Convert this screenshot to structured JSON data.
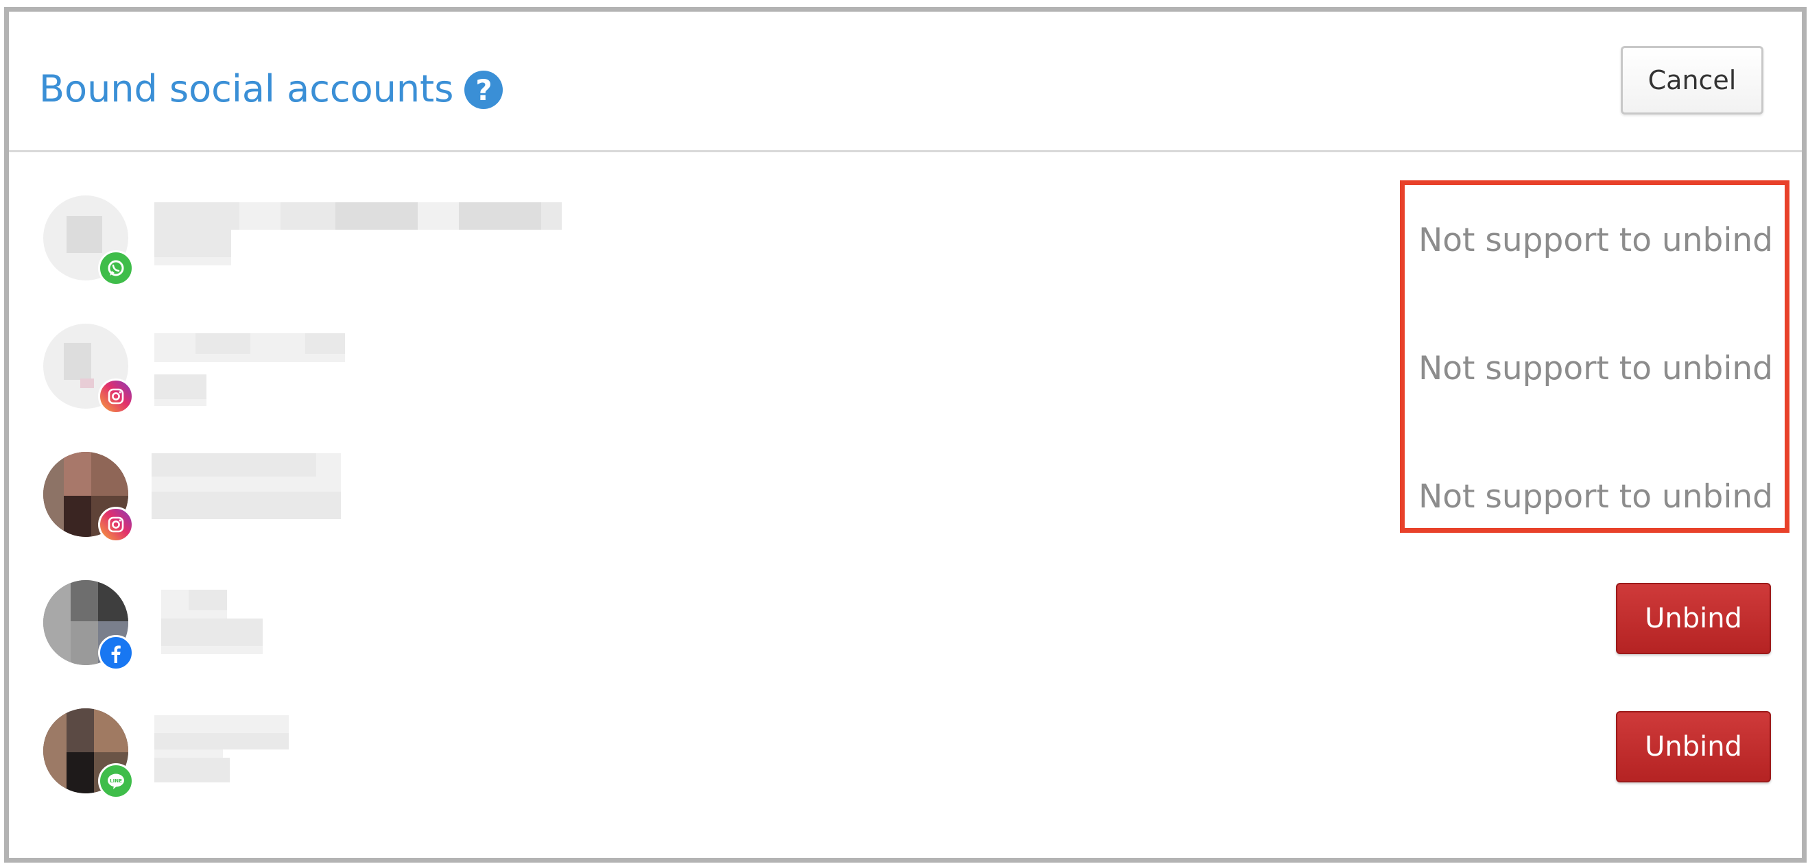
{
  "dialog": {
    "title": "Bound social accounts",
    "help_icon": "question-circle-icon",
    "cancel_label": "Cancel"
  },
  "accounts": [
    {
      "platform": "WhatsApp",
      "badge_icon": "whatsapp-icon",
      "action": "Not support to unbind"
    },
    {
      "platform": "Instagram",
      "badge_icon": "instagram-icon",
      "action": "Not support to unbind"
    },
    {
      "platform": "Instagram",
      "badge_icon": "instagram-icon",
      "action": "Not support to unbind"
    },
    {
      "platform": "Facebook",
      "badge_icon": "facebook-icon",
      "action": "Unbind"
    },
    {
      "platform": "LINE",
      "badge_icon": "line-icon",
      "action": "Unbind"
    }
  ],
  "colors": {
    "title": "#3a8fd6",
    "unbind_button": "#c0292b",
    "highlight": "#e8412a",
    "muted_text": "#8c8c8c"
  }
}
